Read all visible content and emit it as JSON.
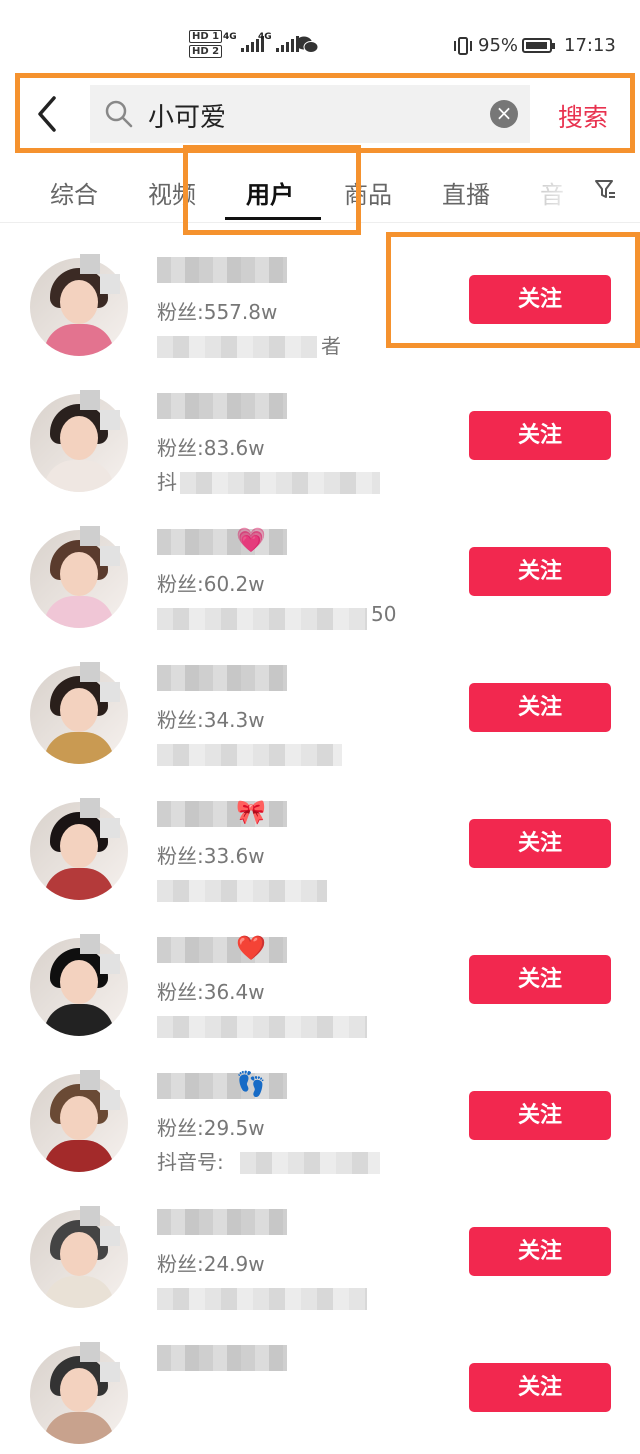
{
  "status_bar": {
    "hd1": "HD 1",
    "hd2": "HD 2",
    "net1": "4G",
    "net2": "4G",
    "battery_pct": "95%",
    "battery_level": 0.95,
    "time": "17:13"
  },
  "search": {
    "query": "小可爱",
    "submit_label": "搜索"
  },
  "tabs": [
    {
      "label": "综合"
    },
    {
      "label": "视频"
    },
    {
      "label": "用户",
      "active": true
    },
    {
      "label": "商品"
    },
    {
      "label": "直播"
    },
    {
      "label": "音"
    }
  ],
  "users": [
    {
      "fans": "粉丝:557.8w",
      "line3": "者",
      "follow": "关注"
    },
    {
      "fans": "粉丝:83.6w",
      "line3": "抖",
      "follow": "关注"
    },
    {
      "fans": "粉丝:60.2w",
      "line3": "50",
      "follow": "关注",
      "emoji": "💗"
    },
    {
      "fans": "粉丝:34.3w",
      "line3": "",
      "follow": "关注"
    },
    {
      "fans": "粉丝:33.6w",
      "line3": "",
      "follow": "关注",
      "emoji": "🎀"
    },
    {
      "fans": "粉丝:36.4w",
      "line3": "",
      "follow": "关注",
      "emoji": "❤️"
    },
    {
      "fans": "粉丝:29.5w",
      "line3": "抖音号:",
      "follow": "关注",
      "emoji": "👣"
    },
    {
      "fans": "粉丝:24.9w",
      "line3": "",
      "follow": "关注"
    },
    {
      "fans": "",
      "line3": "",
      "follow": "关注"
    }
  ],
  "colors": {
    "accent": "#f2284f",
    "highlight": "#f5922e"
  }
}
